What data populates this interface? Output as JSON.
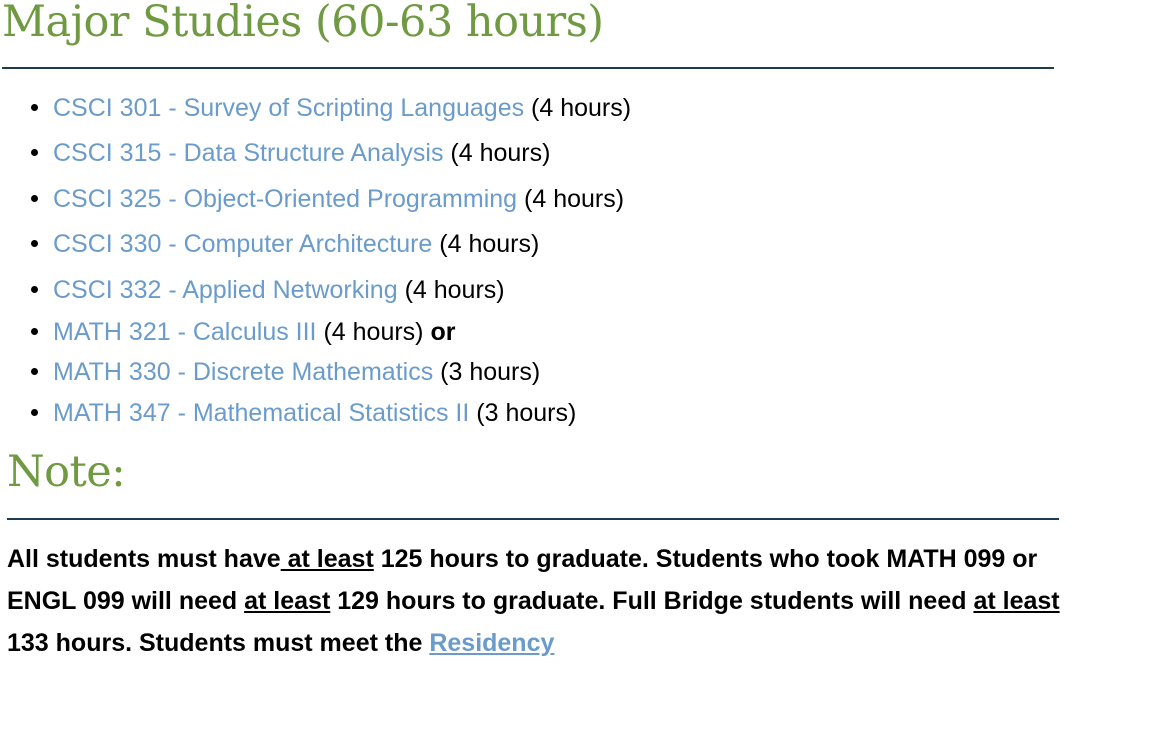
{
  "major_heading": "Major Studies (60-63 hours)",
  "courses": [
    {
      "link": "CSCI 301 - Survey of Scripting Languages",
      "hours": "(4 hours)",
      "or": ""
    },
    {
      "link": "CSCI 315 - Data Structure Analysis",
      "hours": "(4 hours)",
      "or": ""
    },
    {
      "link": "CSCI 325 - Object-Oriented Programming",
      "hours": "(4 hours)",
      "or": ""
    },
    {
      "link": "CSCI 330 - Computer Architecture",
      "hours": "(4 hours)",
      "or": ""
    },
    {
      "link": "CSCI 332 - Applied Networking",
      "hours": "(4 hours)",
      "or": ""
    },
    {
      "link": "MATH 321 - Calculus III",
      "hours": "(4 hours)",
      "or": "or"
    },
    {
      "link": "MATH 330 - Discrete Mathematics",
      "hours": "(3 hours)",
      "or": ""
    },
    {
      "link": "MATH 347 - Mathematical Statistics II",
      "hours": "(3 hours)",
      "or": ""
    }
  ],
  "note_heading": "Note:",
  "note": {
    "p1": "All students must have",
    "u1": " at least",
    "p2": " 125 hours to graduate. Students who took MATH 099 or ENGL 099 will need ",
    "u2": "at least",
    "p3": " 129 hours to graduate. Full Bridge students will need ",
    "u3": "at least",
    "p4": " 133 hours. Students must meet the ",
    "link": "Residency"
  },
  "colors": {
    "heading": "#6f9a42",
    "link": "#6a9bcb",
    "rule": "#1d3b52"
  }
}
